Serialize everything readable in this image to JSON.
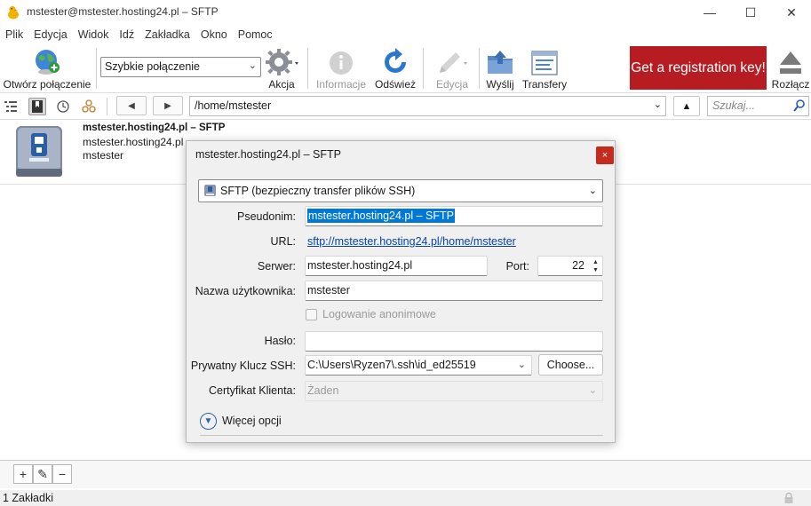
{
  "window": {
    "title": "mstester@mstester.hosting24.pl – SFTP",
    "minimize_glyph": "—",
    "maximize_glyph": "☐",
    "close_glyph": "✕"
  },
  "menu": [
    "Plik",
    "Edycja",
    "Widok",
    "Idź",
    "Zakładka",
    "Okno",
    "Pomoc"
  ],
  "toolbar": {
    "open_connection": "Otwórz połączenie",
    "quick_connect": "Szybkie połączenie",
    "action": "Akcja",
    "info": "Informacje",
    "refresh": "Odśwież",
    "edit": "Edycja",
    "upload": "Wyślij",
    "transfers": "Transfery",
    "registration": "Get a registration key!",
    "disconnect": "Rozłącz"
  },
  "nav": {
    "path": "/home/mstester",
    "search_placeholder": "Szukaj...",
    "back_glyph": "◀",
    "forward_glyph": "▶",
    "up_glyph": "▲"
  },
  "bookmark": {
    "title": "mstester.hosting24.pl – SFTP",
    "host": "mstester.hosting24.pl",
    "user": "mstester"
  },
  "dialog": {
    "title": "mstester.hosting24.pl – SFTP",
    "close_glyph": "×",
    "protocol": "SFTP (bezpieczny transfer plików SSH)",
    "nickname_label": "Pseudonim:",
    "nickname_value": "mstester.hosting24.pl – SFTP",
    "url_label": "URL:",
    "url_value": "sftp://mstester.hosting24.pl/home/mstester",
    "server_label": "Serwer:",
    "server_value": "mstester.hosting24.pl",
    "port_label": "Port:",
    "port_value": "22",
    "username_label": "Nazwa użytkownika:",
    "username_value": "mstester",
    "anonymous_label": "Logowanie anonimowe",
    "password_label": "Hasło:",
    "password_value": "",
    "ssh_key_label": "Prywatny Klucz SSH:",
    "ssh_key_value": "C:\\Users\\Ryzen7\\.ssh\\id_ed25519",
    "choose_label": "Choose...",
    "client_cert_label": "Certyfikat Klienta:",
    "client_cert_value": "Żaden",
    "more_options_label": "Więcej opcji"
  },
  "bottom": {
    "add_glyph": "+",
    "edit_glyph": "✎",
    "remove_glyph": "−",
    "status": "1 Zakładki"
  },
  "colors": {
    "registration_bg": "#b81c23",
    "selection": "#0078d7",
    "close_red": "#c42b1c",
    "link": "#0645ad"
  }
}
